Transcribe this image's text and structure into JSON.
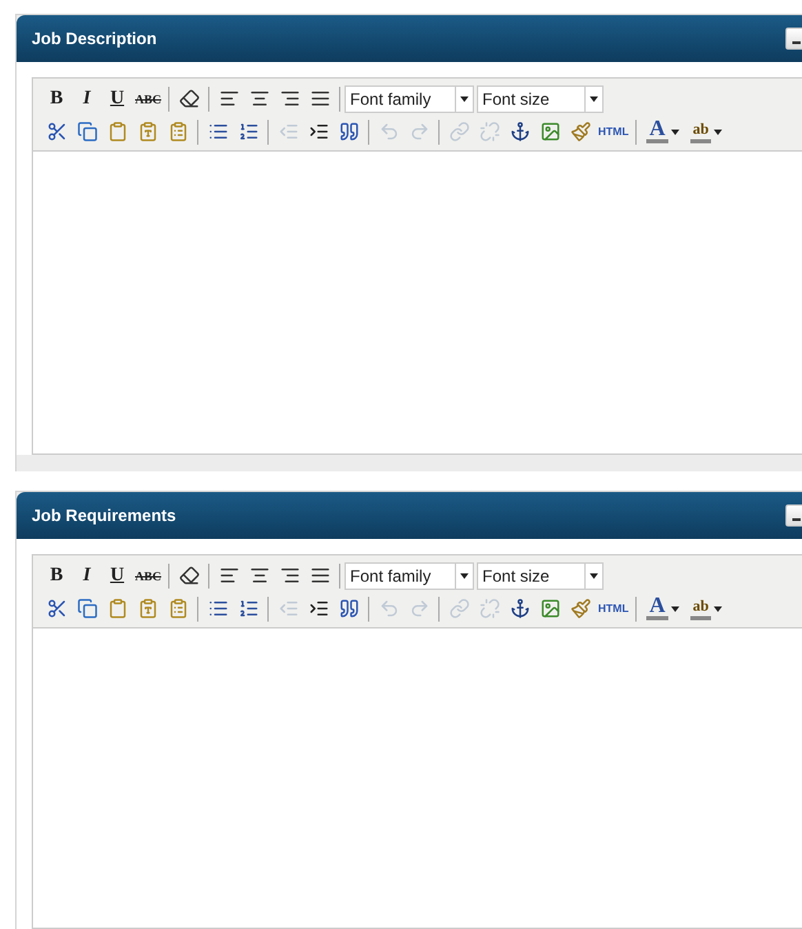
{
  "panels": [
    {
      "title": "Job Description",
      "editor": {
        "row_1": [
          {
            "kind": "bold",
            "label": "B",
            "disabled": false
          },
          {
            "kind": "italic",
            "label": "I",
            "disabled": false
          },
          {
            "kind": "underline",
            "label": "U",
            "disabled": false
          },
          {
            "kind": "strike",
            "label": "ABC",
            "disabled": false
          },
          {
            "kind": "separator"
          },
          {
            "kind": "eraser",
            "disabled": false
          },
          {
            "kind": "separator"
          },
          {
            "kind": "align-left",
            "disabled": false
          },
          {
            "kind": "align-center",
            "disabled": false
          },
          {
            "kind": "align-right",
            "disabled": false
          },
          {
            "kind": "align-justify",
            "disabled": false
          },
          {
            "kind": "separator"
          },
          {
            "kind": "select",
            "label": "Font family"
          },
          {
            "kind": "select",
            "label": "Font size"
          }
        ],
        "row_2": [
          {
            "kind": "cut",
            "disabled": false
          },
          {
            "kind": "copy",
            "disabled": false
          },
          {
            "kind": "paste",
            "disabled": false
          },
          {
            "kind": "paste-text",
            "disabled": false
          },
          {
            "kind": "paste-word",
            "disabled": false
          },
          {
            "kind": "separator"
          },
          {
            "kind": "bullets",
            "disabled": false
          },
          {
            "kind": "numbers",
            "disabled": false
          },
          {
            "kind": "separator"
          },
          {
            "kind": "outdent",
            "disabled": true
          },
          {
            "kind": "indent",
            "disabled": false
          },
          {
            "kind": "quote",
            "disabled": false
          },
          {
            "kind": "separator"
          },
          {
            "kind": "undo",
            "disabled": true
          },
          {
            "kind": "redo",
            "disabled": true
          },
          {
            "kind": "separator"
          },
          {
            "kind": "link",
            "disabled": true
          },
          {
            "kind": "unlink",
            "disabled": true
          },
          {
            "kind": "anchor",
            "disabled": false
          },
          {
            "kind": "image",
            "disabled": false
          },
          {
            "kind": "cleanup",
            "disabled": false
          },
          {
            "kind": "html",
            "label": "HTML",
            "disabled": false
          },
          {
            "kind": "separator"
          },
          {
            "kind": "forecolor",
            "label": "A",
            "disabled": false
          },
          {
            "kind": "backcolor",
            "label": "ab",
            "disabled": false
          }
        ]
      }
    },
    {
      "title": "Job Requirements",
      "editor": {
        "row_1": [
          {
            "kind": "bold",
            "label": "B",
            "disabled": false
          },
          {
            "kind": "italic",
            "label": "I",
            "disabled": false
          },
          {
            "kind": "underline",
            "label": "U",
            "disabled": false
          },
          {
            "kind": "strike",
            "label": "ABC",
            "disabled": false
          },
          {
            "kind": "separator"
          },
          {
            "kind": "eraser",
            "disabled": false
          },
          {
            "kind": "separator"
          },
          {
            "kind": "align-left",
            "disabled": false
          },
          {
            "kind": "align-center",
            "disabled": false
          },
          {
            "kind": "align-right",
            "disabled": false
          },
          {
            "kind": "align-justify",
            "disabled": false
          },
          {
            "kind": "separator"
          },
          {
            "kind": "select",
            "label": "Font family"
          },
          {
            "kind": "select",
            "label": "Font size"
          }
        ],
        "row_2": [
          {
            "kind": "cut",
            "disabled": false
          },
          {
            "kind": "copy",
            "disabled": false
          },
          {
            "kind": "paste",
            "disabled": false
          },
          {
            "kind": "paste-text",
            "disabled": false
          },
          {
            "kind": "paste-word",
            "disabled": false
          },
          {
            "kind": "separator"
          },
          {
            "kind": "bullets",
            "disabled": false
          },
          {
            "kind": "numbers",
            "disabled": false
          },
          {
            "kind": "separator"
          },
          {
            "kind": "outdent",
            "disabled": true
          },
          {
            "kind": "indent",
            "disabled": false
          },
          {
            "kind": "quote",
            "disabled": false
          },
          {
            "kind": "separator"
          },
          {
            "kind": "undo",
            "disabled": true
          },
          {
            "kind": "redo",
            "disabled": true
          },
          {
            "kind": "separator"
          },
          {
            "kind": "link",
            "disabled": true
          },
          {
            "kind": "unlink",
            "disabled": true
          },
          {
            "kind": "anchor",
            "disabled": false
          },
          {
            "kind": "image",
            "disabled": false
          },
          {
            "kind": "cleanup",
            "disabled": false
          },
          {
            "kind": "html",
            "label": "HTML",
            "disabled": false
          },
          {
            "kind": "separator"
          },
          {
            "kind": "forecolor",
            "label": "A",
            "disabled": false
          },
          {
            "kind": "backcolor",
            "label": "ab",
            "disabled": false
          }
        ]
      }
    }
  ]
}
